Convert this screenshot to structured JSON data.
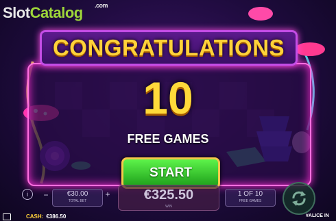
{
  "watermark": {
    "part1": "Slot",
    "part2": "Catalog",
    "part3": ".com"
  },
  "popup": {
    "title": "CONGRATULATIONS",
    "count": "10",
    "subtitle": "FREE GAMES",
    "start_label": "START"
  },
  "hud": {
    "bet_value": "€30.00",
    "bet_label": "TOTAL BET",
    "win_value": "€325.50",
    "win_label": "WIN",
    "free_games_value": "1 OF 10",
    "free_games_label": "FREE GAMES",
    "cash_label": "CASH:",
    "cash_value": "€386.50",
    "game_name": "#ALICE IN"
  },
  "icons": [
    "info-icon",
    "minus-icon",
    "plus-icon",
    "spin-icon",
    "menu-icon",
    "rose-icon",
    "teacups-icon",
    "mushroom-icon"
  ],
  "colors": {
    "accent_gold": "#ffd23a",
    "neon_pink": "#ff4fe6",
    "start_green": "#2fc12a",
    "panel_purple": "#3a0f66"
  }
}
